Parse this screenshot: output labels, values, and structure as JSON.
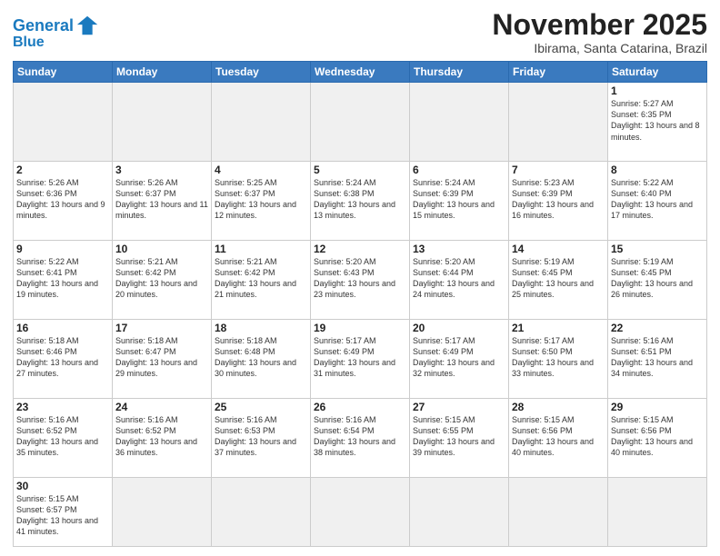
{
  "header": {
    "logo_general": "General",
    "logo_blue": "Blue",
    "month_title": "November 2025",
    "location": "Ibirama, Santa Catarina, Brazil"
  },
  "weekdays": [
    "Sunday",
    "Monday",
    "Tuesday",
    "Wednesday",
    "Thursday",
    "Friday",
    "Saturday"
  ],
  "weeks": [
    [
      {
        "day": "",
        "info": ""
      },
      {
        "day": "",
        "info": ""
      },
      {
        "day": "",
        "info": ""
      },
      {
        "day": "",
        "info": ""
      },
      {
        "day": "",
        "info": ""
      },
      {
        "day": "",
        "info": ""
      },
      {
        "day": "1",
        "info": "Sunrise: 5:27 AM\nSunset: 6:35 PM\nDaylight: 13 hours and 8 minutes."
      }
    ],
    [
      {
        "day": "2",
        "info": "Sunrise: 5:26 AM\nSunset: 6:36 PM\nDaylight: 13 hours and 9 minutes."
      },
      {
        "day": "3",
        "info": "Sunrise: 5:26 AM\nSunset: 6:37 PM\nDaylight: 13 hours and 11 minutes."
      },
      {
        "day": "4",
        "info": "Sunrise: 5:25 AM\nSunset: 6:37 PM\nDaylight: 13 hours and 12 minutes."
      },
      {
        "day": "5",
        "info": "Sunrise: 5:24 AM\nSunset: 6:38 PM\nDaylight: 13 hours and 13 minutes."
      },
      {
        "day": "6",
        "info": "Sunrise: 5:24 AM\nSunset: 6:39 PM\nDaylight: 13 hours and 15 minutes."
      },
      {
        "day": "7",
        "info": "Sunrise: 5:23 AM\nSunset: 6:39 PM\nDaylight: 13 hours and 16 minutes."
      },
      {
        "day": "8",
        "info": "Sunrise: 5:22 AM\nSunset: 6:40 PM\nDaylight: 13 hours and 17 minutes."
      }
    ],
    [
      {
        "day": "9",
        "info": "Sunrise: 5:22 AM\nSunset: 6:41 PM\nDaylight: 13 hours and 19 minutes."
      },
      {
        "day": "10",
        "info": "Sunrise: 5:21 AM\nSunset: 6:42 PM\nDaylight: 13 hours and 20 minutes."
      },
      {
        "day": "11",
        "info": "Sunrise: 5:21 AM\nSunset: 6:42 PM\nDaylight: 13 hours and 21 minutes."
      },
      {
        "day": "12",
        "info": "Sunrise: 5:20 AM\nSunset: 6:43 PM\nDaylight: 13 hours and 23 minutes."
      },
      {
        "day": "13",
        "info": "Sunrise: 5:20 AM\nSunset: 6:44 PM\nDaylight: 13 hours and 24 minutes."
      },
      {
        "day": "14",
        "info": "Sunrise: 5:19 AM\nSunset: 6:45 PM\nDaylight: 13 hours and 25 minutes."
      },
      {
        "day": "15",
        "info": "Sunrise: 5:19 AM\nSunset: 6:45 PM\nDaylight: 13 hours and 26 minutes."
      }
    ],
    [
      {
        "day": "16",
        "info": "Sunrise: 5:18 AM\nSunset: 6:46 PM\nDaylight: 13 hours and 27 minutes."
      },
      {
        "day": "17",
        "info": "Sunrise: 5:18 AM\nSunset: 6:47 PM\nDaylight: 13 hours and 29 minutes."
      },
      {
        "day": "18",
        "info": "Sunrise: 5:18 AM\nSunset: 6:48 PM\nDaylight: 13 hours and 30 minutes."
      },
      {
        "day": "19",
        "info": "Sunrise: 5:17 AM\nSunset: 6:49 PM\nDaylight: 13 hours and 31 minutes."
      },
      {
        "day": "20",
        "info": "Sunrise: 5:17 AM\nSunset: 6:49 PM\nDaylight: 13 hours and 32 minutes."
      },
      {
        "day": "21",
        "info": "Sunrise: 5:17 AM\nSunset: 6:50 PM\nDaylight: 13 hours and 33 minutes."
      },
      {
        "day": "22",
        "info": "Sunrise: 5:16 AM\nSunset: 6:51 PM\nDaylight: 13 hours and 34 minutes."
      }
    ],
    [
      {
        "day": "23",
        "info": "Sunrise: 5:16 AM\nSunset: 6:52 PM\nDaylight: 13 hours and 35 minutes."
      },
      {
        "day": "24",
        "info": "Sunrise: 5:16 AM\nSunset: 6:52 PM\nDaylight: 13 hours and 36 minutes."
      },
      {
        "day": "25",
        "info": "Sunrise: 5:16 AM\nSunset: 6:53 PM\nDaylight: 13 hours and 37 minutes."
      },
      {
        "day": "26",
        "info": "Sunrise: 5:16 AM\nSunset: 6:54 PM\nDaylight: 13 hours and 38 minutes."
      },
      {
        "day": "27",
        "info": "Sunrise: 5:15 AM\nSunset: 6:55 PM\nDaylight: 13 hours and 39 minutes."
      },
      {
        "day": "28",
        "info": "Sunrise: 5:15 AM\nSunset: 6:56 PM\nDaylight: 13 hours and 40 minutes."
      },
      {
        "day": "29",
        "info": "Sunrise: 5:15 AM\nSunset: 6:56 PM\nDaylight: 13 hours and 40 minutes."
      }
    ],
    [
      {
        "day": "30",
        "info": "Sunrise: 5:15 AM\nSunset: 6:57 PM\nDaylight: 13 hours and 41 minutes."
      },
      {
        "day": "",
        "info": ""
      },
      {
        "day": "",
        "info": ""
      },
      {
        "day": "",
        "info": ""
      },
      {
        "day": "",
        "info": ""
      },
      {
        "day": "",
        "info": ""
      },
      {
        "day": "",
        "info": ""
      }
    ]
  ]
}
